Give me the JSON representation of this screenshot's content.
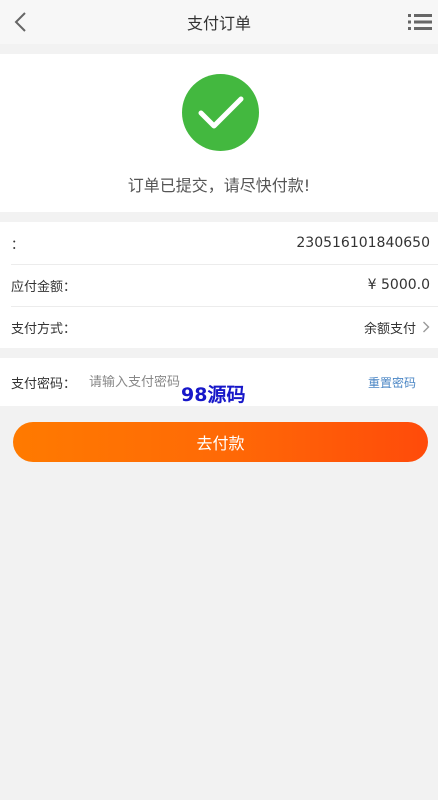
{
  "header": {
    "title": "支付订单",
    "back_icon": "chevron-left-icon",
    "menu_icon": "list-menu-icon"
  },
  "success": {
    "icon": "check-circle-icon",
    "icon_color": "#43b83f",
    "message": "订单已提交，请尽快付款!"
  },
  "order": {
    "order_label": "：",
    "order_no": "230516101840650",
    "amount_label": "应付金额：",
    "amount": "¥ 5000.0",
    "method_label": "支付方式：",
    "method": "余额支付"
  },
  "password": {
    "label": "支付密码：",
    "placeholder": "请输入支付密码",
    "reset": "重置密码"
  },
  "watermark": "98源码",
  "pay_button": "去付款",
  "colors": {
    "accent": "#ff6a06",
    "link": "#4a86c5",
    "success": "#43b83f"
  }
}
